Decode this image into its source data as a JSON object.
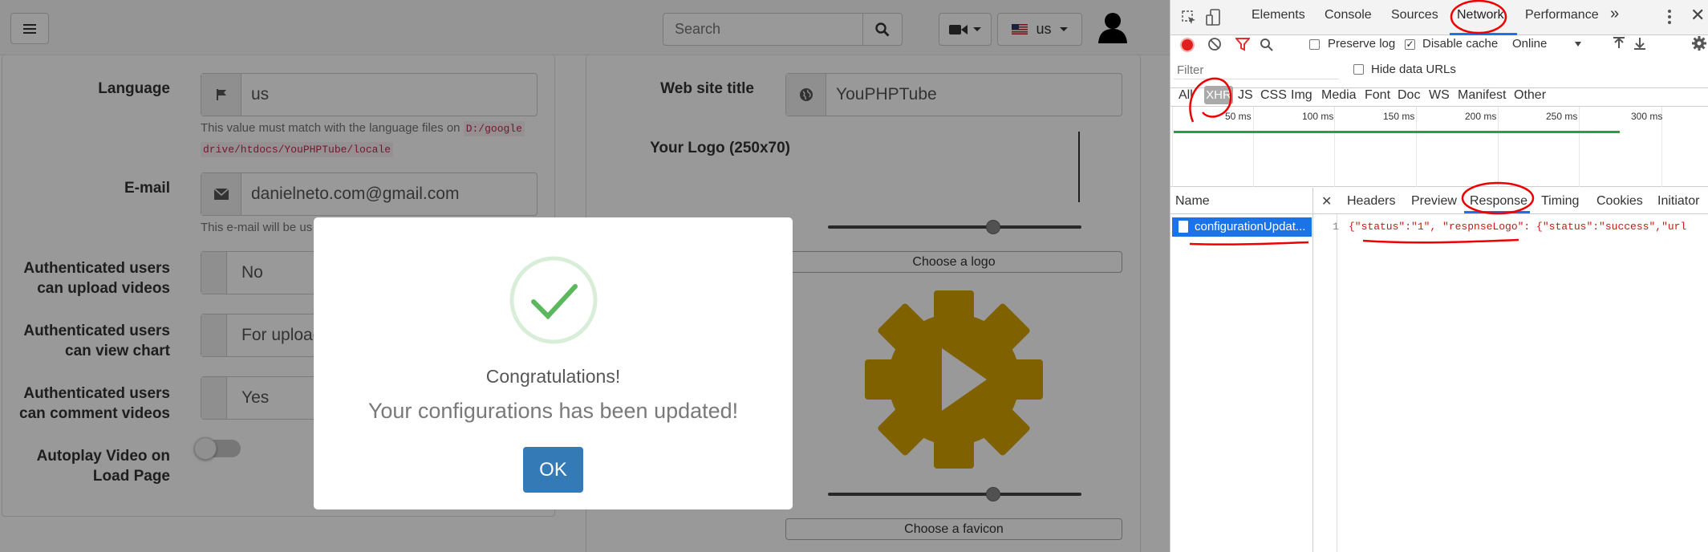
{
  "navbar": {
    "menu_icon": "hamburger-icon",
    "search_placeholder": "Search",
    "lang_label": "us"
  },
  "left_form": {
    "language_label": "Language",
    "language_value": "us",
    "language_help": "This value must match with the language files on",
    "language_path_1": "D:/google",
    "language_path_2": "drive/htdocs/YouPHPTube/locale",
    "email_label": "E-mail",
    "email_value": "danielneto.com@gmail.com",
    "email_help": "This e-mail will be us",
    "upload_label_1": "Authenticated users",
    "upload_label_2": "can upload videos",
    "upload_value": "No",
    "chart_label_1": "Authenticated users",
    "chart_label_2": "can view chart",
    "chart_value": "For upload",
    "comment_label_1": "Authenticated users",
    "comment_label_2": "can comment videos",
    "comment_value": "Yes",
    "autoplay_label_1": "Autoplay Video on",
    "autoplay_label_2": "Load Page",
    "autoplay_on": false
  },
  "right_form": {
    "site_title_label": "Web site title",
    "site_title_value": "YouPHPTube",
    "logo_label": "Your Logo (250x70)",
    "choose_logo": "Choose a logo",
    "choose_favicon": "Choose a favicon"
  },
  "modal": {
    "title": "Congratulations!",
    "message": "Your configurations has been updated!",
    "ok_label": "OK",
    "success_color": "#5cb85c"
  },
  "devtools": {
    "tabs": [
      "Elements",
      "Console",
      "Sources",
      "Network",
      "Performance"
    ],
    "more": "»",
    "active_tab": "Network",
    "preserve_log": "Preserve log",
    "preserve_log_checked": false,
    "disable_cache": "Disable cache",
    "disable_cache_checked": true,
    "throttle": "Online",
    "filter_placeholder": "Filter",
    "hide_data_urls": "Hide data URLs",
    "filter_types": [
      "All",
      "XHR",
      "JS",
      "CSS",
      "Img",
      "Media",
      "Font",
      "Doc",
      "WS",
      "Manifest",
      "Other"
    ],
    "active_filter": "XHR",
    "timeline_ticks": [
      "50 ms",
      "100 ms",
      "150 ms",
      "200 ms",
      "250 ms",
      "300 ms"
    ],
    "name_header": "Name",
    "request_name": "configurationUpdat...",
    "detail_tabs": [
      "Headers",
      "Preview",
      "Response",
      "Timing",
      "Cookies",
      "Initiator"
    ],
    "active_detail_tab": "Response",
    "response_line_no": "1",
    "response_text": "{\"status\":\"1\", \"respnseLogo\": {\"status\":\"success\",\"url"
  }
}
